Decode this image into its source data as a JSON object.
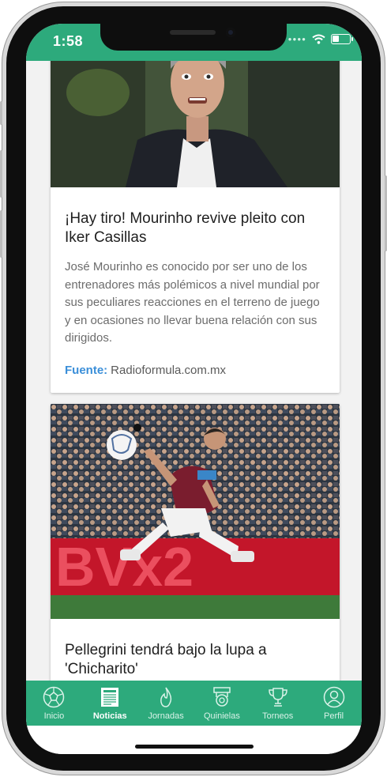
{
  "status_bar": {
    "time": "1:58"
  },
  "articles": [
    {
      "title": "¡Hay tiro! Mourinho revive pleito con Iker Casillas",
      "summary": "José Mourinho es conocido por ser uno de los entrenadores más polémicos a nivel mundial por sus peculiares reacciones en el terreno de juego y en ocasiones no llevar buena relación con sus dirigidos.",
      "source_label": "Fuente:",
      "source": "Radioformula.com.mx"
    },
    {
      "title": "Pellegrini tendrá bajo la lupa a 'Chicharito'",
      "billboard_text": "BVx2"
    }
  ],
  "tab_bar": {
    "active": "Noticias",
    "tabs": [
      {
        "label": "Inicio",
        "icon": "soccer-ball-icon"
      },
      {
        "label": "Noticias",
        "icon": "newspaper-icon"
      },
      {
        "label": "Jornadas",
        "icon": "flame-icon"
      },
      {
        "label": "Quinielas",
        "icon": "badge-icon"
      },
      {
        "label": "Torneos",
        "icon": "trophy-icon"
      },
      {
        "label": "Perfil",
        "icon": "profile-icon"
      }
    ]
  },
  "colors": {
    "brand": "#2daa7c",
    "source_label": "#3b8fd9"
  }
}
